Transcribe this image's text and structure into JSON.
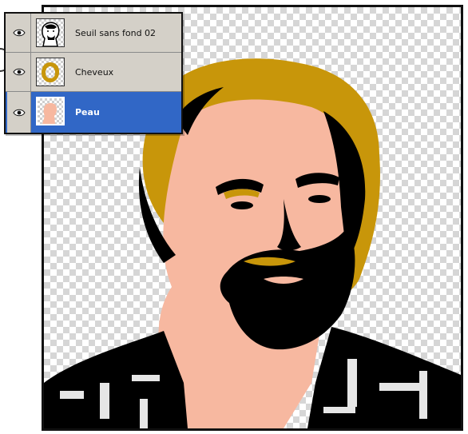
{
  "layers_panel": {
    "layers": [
      {
        "name": "Seuil sans fond 02",
        "visible": true,
        "selected": false,
        "thumbnail": "threshold-portrait"
      },
      {
        "name": "Cheveux",
        "visible": true,
        "selected": false,
        "thumbnail": "hair-ring"
      },
      {
        "name": "Peau",
        "visible": true,
        "selected": true,
        "thumbnail": "skin-silhouette"
      }
    ]
  },
  "colors": {
    "hair": "#c8960a",
    "skin": "#f7b8a0",
    "ink": "#000000",
    "selection": "#3167c6",
    "panel": "#d4d0c8"
  }
}
